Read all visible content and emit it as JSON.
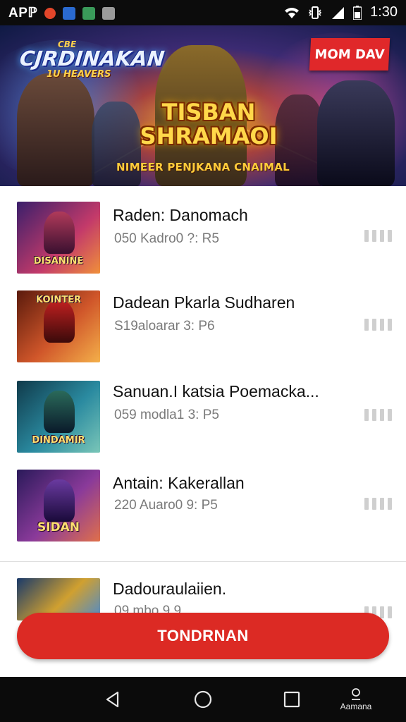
{
  "status_bar": {
    "left_text": "APℙ",
    "time": "1:30",
    "colors": {
      "background": "#0c0c0c",
      "text": "#ffffff"
    },
    "left_icons": [
      "notification-red-icon",
      "notification-blue-icon",
      "notification-gallery-icon",
      "notification-clipboard-icon"
    ],
    "right_icons": [
      "wifi-icon",
      "vibrate-icon",
      "signal-icon",
      "battery-icon"
    ]
  },
  "banner": {
    "title_small": "CBE",
    "title": "CJRDINAKAN",
    "subtitle": "1U HEAVERS",
    "center_title_line1": "TISBAN",
    "center_title_line2": "SHRAMAOI",
    "tagline": "NIMEER PENJKANA CNAIMAL",
    "badge": "MOM DAV",
    "badge_color": "#e0282a"
  },
  "list": {
    "items": [
      {
        "title": "Raden: Danomach",
        "subtitle": "050 Kadro0 ?: R5",
        "thumb_caption": "DISANINE",
        "thumb_colors": [
          "#3a1f6b",
          "#c33a6a",
          "#f0903a"
        ]
      },
      {
        "title": "Dadean Pkarla Sudharen",
        "subtitle": "S19aloarar 3: P6",
        "thumb_caption": "KOINTER",
        "thumb_colors": [
          "#5a1a0c",
          "#d0562a",
          "#f4b04a"
        ]
      },
      {
        "title": "Sanuan.I katsia Poemacka...",
        "subtitle": "059 modla1 3: P5",
        "thumb_caption": "DINDAMIR",
        "thumb_colors": [
          "#103a4a",
          "#2a8aa0",
          "#7ac6b8"
        ]
      },
      {
        "title": "Antain: Kakerallan",
        "subtitle": "220 Auaro0 9: P5",
        "thumb_caption": "SIDAN",
        "thumb_colors": [
          "#2a1a5a",
          "#8a3a9a",
          "#e0704a"
        ]
      },
      {
        "title": "Dadouraulaiien.",
        "subtitle": "09 mbo 9 9",
        "thumb_caption": "",
        "thumb_colors": [
          "#1a3a6a",
          "#d0a030",
          "#4a8ad0"
        ]
      }
    ]
  },
  "cta": {
    "label": "TONDRNAN",
    "color": "#dc2a24"
  },
  "nav_bar": {
    "recents_label": "Aamana"
  }
}
